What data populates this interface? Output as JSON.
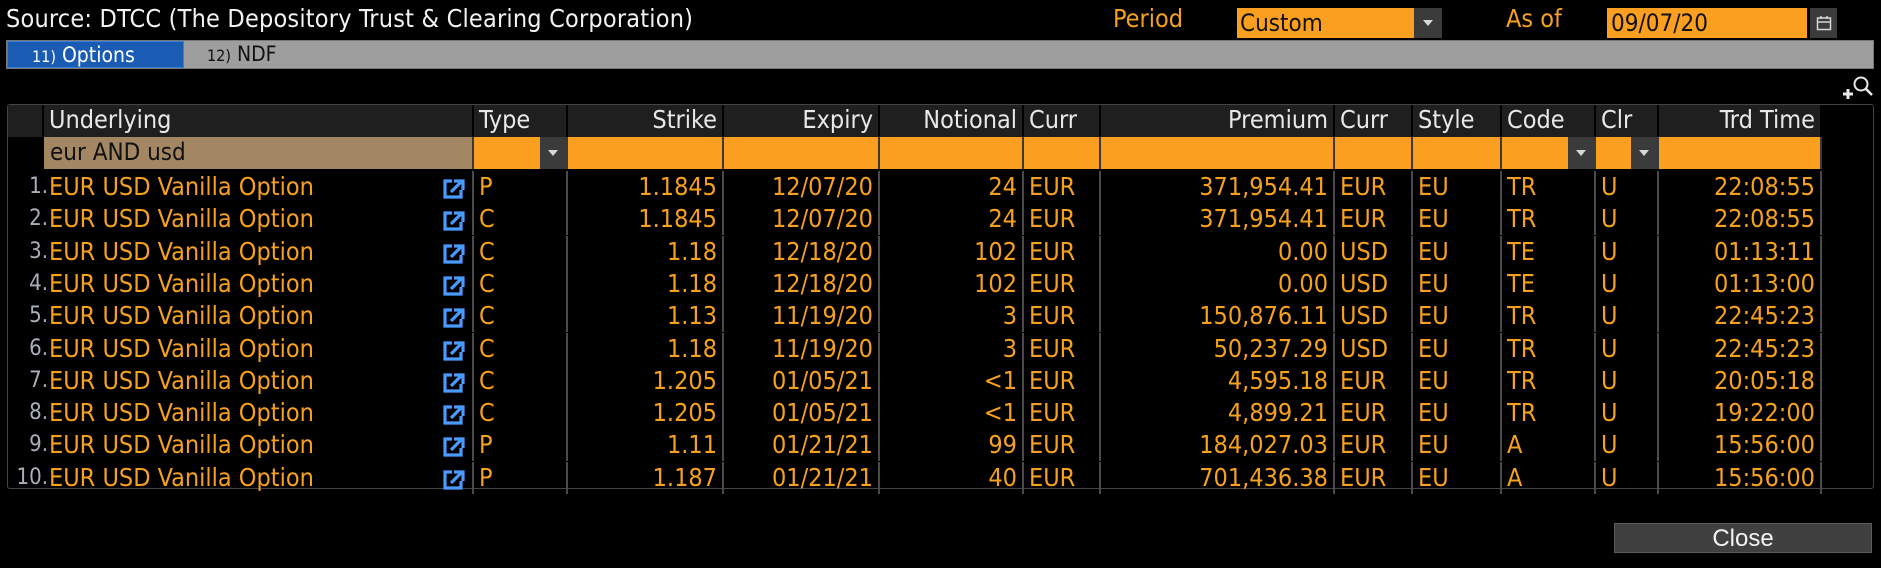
{
  "header": {
    "source_text": "Source: DTCC (The Depository Trust & Clearing Corporation)",
    "period_label": "Period",
    "period_value": "Custom",
    "asof_label": "As of",
    "asof_value": "09/07/20",
    "calendar_icon": "calendar-icon",
    "period_dropdown_icon": "chevron-down-icon"
  },
  "tabs": [
    {
      "num": "11)",
      "label": "Options",
      "active": true
    },
    {
      "num": "12)",
      "label": "NDF",
      "active": false
    }
  ],
  "toolbar": {
    "zoom_icon": "zoom-in-icon"
  },
  "columns": [
    "Underlying",
    "Type",
    "Strike",
    "Expiry",
    "Notional",
    "Curr",
    "Premium",
    "Curr",
    "Style",
    "Code",
    "Clr",
    "Trd Time"
  ],
  "filters": {
    "underlying": "eur AND usd",
    "type": "",
    "code": "",
    "clr": ""
  },
  "rows": [
    {
      "num": "1.",
      "underlying": "EUR USD Vanilla Option",
      "type": "P",
      "strike": "1.1845",
      "expiry": "12/07/20",
      "notional": "24",
      "curr": "EUR",
      "premium": "371,954.41",
      "prem_curr": "EUR",
      "style": "EU",
      "code": "TR",
      "clr": "U",
      "time": "22:08:55"
    },
    {
      "num": "2.",
      "underlying": "EUR USD Vanilla Option",
      "type": "C",
      "strike": "1.1845",
      "expiry": "12/07/20",
      "notional": "24",
      "curr": "EUR",
      "premium": "371,954.41",
      "prem_curr": "EUR",
      "style": "EU",
      "code": "TR",
      "clr": "U",
      "time": "22:08:55"
    },
    {
      "num": "3.",
      "underlying": "EUR USD Vanilla Option",
      "type": "C",
      "strike": "1.18",
      "expiry": "12/18/20",
      "notional": "102",
      "curr": "EUR",
      "premium": "0.00",
      "prem_curr": "USD",
      "style": "EU",
      "code": "TE",
      "clr": "U",
      "time": "01:13:11"
    },
    {
      "num": "4.",
      "underlying": "EUR USD Vanilla Option",
      "type": "C",
      "strike": "1.18",
      "expiry": "12/18/20",
      "notional": "102",
      "curr": "EUR",
      "premium": "0.00",
      "prem_curr": "USD",
      "style": "EU",
      "code": "TE",
      "clr": "U",
      "time": "01:13:00"
    },
    {
      "num": "5.",
      "underlying": "EUR USD Vanilla Option",
      "type": "C",
      "strike": "1.13",
      "expiry": "11/19/20",
      "notional": "3",
      "curr": "EUR",
      "premium": "150,876.11",
      "prem_curr": "USD",
      "style": "EU",
      "code": "TR",
      "clr": "U",
      "time": "22:45:23"
    },
    {
      "num": "6.",
      "underlying": "EUR USD Vanilla Option",
      "type": "C",
      "strike": "1.18",
      "expiry": "11/19/20",
      "notional": "3",
      "curr": "EUR",
      "premium": "50,237.29",
      "prem_curr": "USD",
      "style": "EU",
      "code": "TR",
      "clr": "U",
      "time": "22:45:23"
    },
    {
      "num": "7.",
      "underlying": "EUR USD Vanilla Option",
      "type": "C",
      "strike": "1.205",
      "expiry": "01/05/21",
      "notional": "<1",
      "curr": "EUR",
      "premium": "4,595.18",
      "prem_curr": "EUR",
      "style": "EU",
      "code": "TR",
      "clr": "U",
      "time": "20:05:18"
    },
    {
      "num": "8.",
      "underlying": "EUR USD Vanilla Option",
      "type": "C",
      "strike": "1.205",
      "expiry": "01/05/21",
      "notional": "<1",
      "curr": "EUR",
      "premium": "4,899.21",
      "prem_curr": "EUR",
      "style": "EU",
      "code": "TR",
      "clr": "U",
      "time": "19:22:00"
    },
    {
      "num": "9.",
      "underlying": "EUR USD Vanilla Option",
      "type": "P",
      "strike": "1.11",
      "expiry": "01/21/21",
      "notional": "99",
      "curr": "EUR",
      "premium": "184,027.03",
      "prem_curr": "EUR",
      "style": "EU",
      "code": "A",
      "clr": "U",
      "time": "15:56:00"
    },
    {
      "num": "10.",
      "underlying": "EUR USD Vanilla Option",
      "type": "P",
      "strike": "1.187",
      "expiry": "01/21/21",
      "notional": "40",
      "curr": "EUR",
      "premium": "701,436.38",
      "prem_curr": "EUR",
      "style": "EU",
      "code": "A",
      "clr": "U",
      "time": "15:56:00"
    }
  ],
  "footer": {
    "close_label": "Close"
  },
  "colors": {
    "accent": "#fb9f21",
    "text_orange": "#f5a11f",
    "tab_active": "#1a5cb3",
    "link_icon": "#4a9bff"
  }
}
